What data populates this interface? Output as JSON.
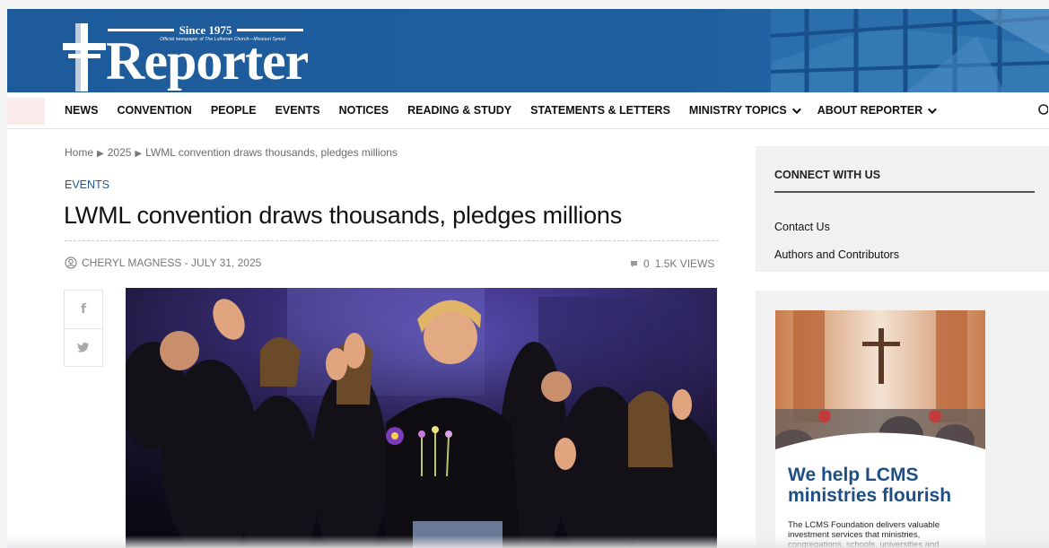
{
  "brand": {
    "since": "Since 1975",
    "tagline": "Official newspaper of The Lutheran Church—Missouri Synod",
    "wordmark": "Reporter",
    "primary_color": "#1d5b9b"
  },
  "nav": {
    "items": [
      {
        "label": "NEWS"
      },
      {
        "label": "CONVENTION"
      },
      {
        "label": "PEOPLE"
      },
      {
        "label": "EVENTS"
      },
      {
        "label": "NOTICES"
      },
      {
        "label": "READING & STUDY"
      },
      {
        "label": "STATEMENTS & LETTERS"
      },
      {
        "label": "MINISTRY TOPICS",
        "has_dropdown": true
      },
      {
        "label": "ABOUT REPORTER",
        "has_dropdown": true
      }
    ],
    "search_icon": "search-icon"
  },
  "breadcrumb": {
    "home": "Home",
    "year": "2025",
    "current": "LWML convention draws thousands, pledges millions"
  },
  "article": {
    "category": "EVENTS",
    "title": "LWML convention draws thousands, pledges millions",
    "author_date": "CHERYL MAGNESS - JULY 31, 2025",
    "comments": "0",
    "views": "1.5K VIEWS",
    "share": [
      "facebook-icon",
      "twitter-icon"
    ]
  },
  "sidebar": {
    "connect_title": "CONNECT WITH US",
    "links": [
      {
        "label": "Contact Us"
      },
      {
        "label": "Authors and Contributors"
      }
    ],
    "ad": {
      "headline": "We help LCMS ministries flourish",
      "body": "The LCMS Foundation delivers valuable investment services that ministries, congregations, schools, universities and"
    }
  }
}
